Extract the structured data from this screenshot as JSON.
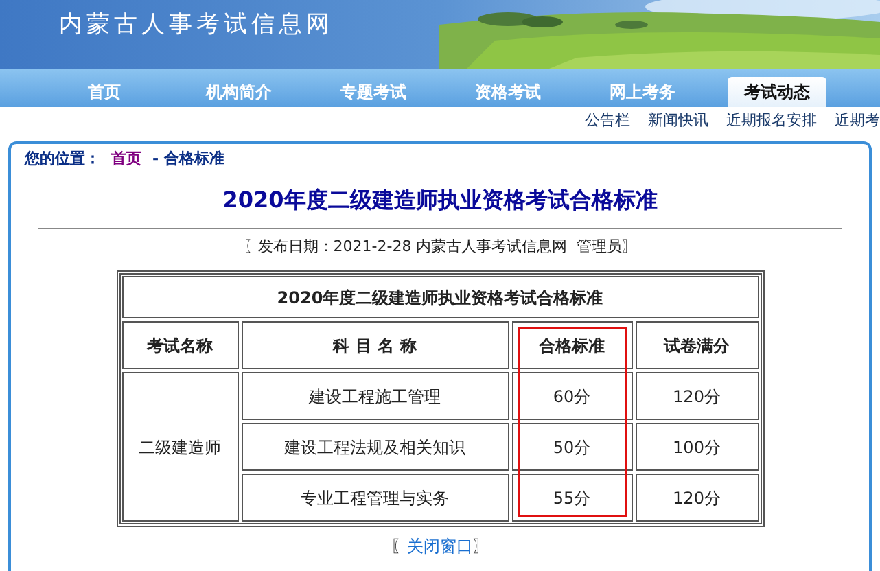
{
  "site_title": "内蒙古人事考试信息网",
  "nav": [
    {
      "label": "首页",
      "selected": false
    },
    {
      "label": "机构简介",
      "selected": false
    },
    {
      "label": "专题考试",
      "selected": false
    },
    {
      "label": "资格考试",
      "selected": false
    },
    {
      "label": "网上考务",
      "selected": false
    },
    {
      "label": "考试动态",
      "selected": true
    }
  ],
  "subnav": [
    "公告栏",
    "新闻快讯",
    "近期报名安排",
    "近期考"
  ],
  "breadcrumb": {
    "label": "您的位置：",
    "links": [
      "首页",
      "- 合格标准"
    ]
  },
  "article": {
    "title": "2020年度二级建造师执业资格考试合格标准",
    "meta": "〖发布日期：2021-2-28 内蒙古人事考试信息网  管理员〗"
  },
  "table": {
    "title": "2020年度二级建造师执业资格考试合格标准",
    "columns": [
      {
        "label": "考试名称",
        "highlighted": false
      },
      {
        "label": "科 目 名 称",
        "highlighted": false
      },
      {
        "label": "合格标准",
        "highlighted": true
      },
      {
        "label": "试卷满分",
        "highlighted": false
      }
    ],
    "groups": [
      {
        "exam": "二级建造师",
        "rows": [
          {
            "subject": "建设工程施工管理",
            "pass": "60分",
            "full": "120分"
          },
          {
            "subject": "建设工程法规及相关知识",
            "pass": "50分",
            "full": "100分"
          },
          {
            "subject": "专业工程管理与实务",
            "pass": "55分",
            "full": "120分"
          }
        ]
      }
    ]
  },
  "close": {
    "open": "〖",
    "link": "关闭窗口",
    "end": "〗"
  }
}
